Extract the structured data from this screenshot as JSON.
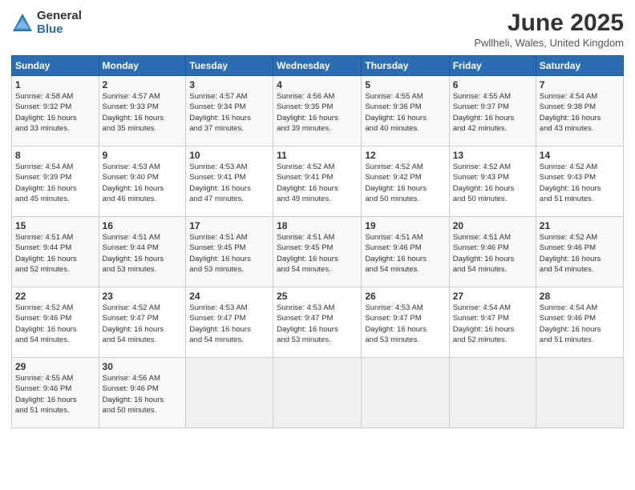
{
  "logo": {
    "general": "General",
    "blue": "Blue"
  },
  "title": "June 2025",
  "subtitle": "Pwllheli, Wales, United Kingdom",
  "weekdays": [
    "Sunday",
    "Monday",
    "Tuesday",
    "Wednesday",
    "Thursday",
    "Friday",
    "Saturday"
  ],
  "weeks": [
    [
      {
        "day": "1",
        "info": "Sunrise: 4:58 AM\nSunset: 9:32 PM\nDaylight: 16 hours\nand 33 minutes."
      },
      {
        "day": "2",
        "info": "Sunrise: 4:57 AM\nSunset: 9:33 PM\nDaylight: 16 hours\nand 35 minutes."
      },
      {
        "day": "3",
        "info": "Sunrise: 4:57 AM\nSunset: 9:34 PM\nDaylight: 16 hours\nand 37 minutes."
      },
      {
        "day": "4",
        "info": "Sunrise: 4:56 AM\nSunset: 9:35 PM\nDaylight: 16 hours\nand 39 minutes."
      },
      {
        "day": "5",
        "info": "Sunrise: 4:55 AM\nSunset: 9:36 PM\nDaylight: 16 hours\nand 40 minutes."
      },
      {
        "day": "6",
        "info": "Sunrise: 4:55 AM\nSunset: 9:37 PM\nDaylight: 16 hours\nand 42 minutes."
      },
      {
        "day": "7",
        "info": "Sunrise: 4:54 AM\nSunset: 9:38 PM\nDaylight: 16 hours\nand 43 minutes."
      }
    ],
    [
      {
        "day": "8",
        "info": "Sunrise: 4:54 AM\nSunset: 9:39 PM\nDaylight: 16 hours\nand 45 minutes."
      },
      {
        "day": "9",
        "info": "Sunrise: 4:53 AM\nSunset: 9:40 PM\nDaylight: 16 hours\nand 46 minutes."
      },
      {
        "day": "10",
        "info": "Sunrise: 4:53 AM\nSunset: 9:41 PM\nDaylight: 16 hours\nand 47 minutes."
      },
      {
        "day": "11",
        "info": "Sunrise: 4:52 AM\nSunset: 9:41 PM\nDaylight: 16 hours\nand 49 minutes."
      },
      {
        "day": "12",
        "info": "Sunrise: 4:52 AM\nSunset: 9:42 PM\nDaylight: 16 hours\nand 50 minutes."
      },
      {
        "day": "13",
        "info": "Sunrise: 4:52 AM\nSunset: 9:43 PM\nDaylight: 16 hours\nand 50 minutes."
      },
      {
        "day": "14",
        "info": "Sunrise: 4:52 AM\nSunset: 9:43 PM\nDaylight: 16 hours\nand 51 minutes."
      }
    ],
    [
      {
        "day": "15",
        "info": "Sunrise: 4:51 AM\nSunset: 9:44 PM\nDaylight: 16 hours\nand 52 minutes."
      },
      {
        "day": "16",
        "info": "Sunrise: 4:51 AM\nSunset: 9:44 PM\nDaylight: 16 hours\nand 53 minutes."
      },
      {
        "day": "17",
        "info": "Sunrise: 4:51 AM\nSunset: 9:45 PM\nDaylight: 16 hours\nand 53 minutes."
      },
      {
        "day": "18",
        "info": "Sunrise: 4:51 AM\nSunset: 9:45 PM\nDaylight: 16 hours\nand 54 minutes."
      },
      {
        "day": "19",
        "info": "Sunrise: 4:51 AM\nSunset: 9:46 PM\nDaylight: 16 hours\nand 54 minutes."
      },
      {
        "day": "20",
        "info": "Sunrise: 4:51 AM\nSunset: 9:46 PM\nDaylight: 16 hours\nand 54 minutes."
      },
      {
        "day": "21",
        "info": "Sunrise: 4:52 AM\nSunset: 9:46 PM\nDaylight: 16 hours\nand 54 minutes."
      }
    ],
    [
      {
        "day": "22",
        "info": "Sunrise: 4:52 AM\nSunset: 9:46 PM\nDaylight: 16 hours\nand 54 minutes."
      },
      {
        "day": "23",
        "info": "Sunrise: 4:52 AM\nSunset: 9:47 PM\nDaylight: 16 hours\nand 54 minutes."
      },
      {
        "day": "24",
        "info": "Sunrise: 4:53 AM\nSunset: 9:47 PM\nDaylight: 16 hours\nand 54 minutes."
      },
      {
        "day": "25",
        "info": "Sunrise: 4:53 AM\nSunset: 9:47 PM\nDaylight: 16 hours\nand 53 minutes."
      },
      {
        "day": "26",
        "info": "Sunrise: 4:53 AM\nSunset: 9:47 PM\nDaylight: 16 hours\nand 53 minutes."
      },
      {
        "day": "27",
        "info": "Sunrise: 4:54 AM\nSunset: 9:47 PM\nDaylight: 16 hours\nand 52 minutes."
      },
      {
        "day": "28",
        "info": "Sunrise: 4:54 AM\nSunset: 9:46 PM\nDaylight: 16 hours\nand 51 minutes."
      }
    ],
    [
      {
        "day": "29",
        "info": "Sunrise: 4:55 AM\nSunset: 9:46 PM\nDaylight: 16 hours\nand 51 minutes."
      },
      {
        "day": "30",
        "info": "Sunrise: 4:56 AM\nSunset: 9:46 PM\nDaylight: 16 hours\nand 50 minutes."
      },
      {
        "day": "",
        "info": ""
      },
      {
        "day": "",
        "info": ""
      },
      {
        "day": "",
        "info": ""
      },
      {
        "day": "",
        "info": ""
      },
      {
        "day": "",
        "info": ""
      }
    ]
  ]
}
